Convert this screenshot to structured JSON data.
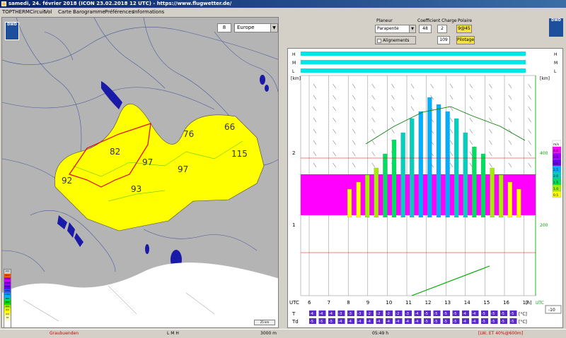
{
  "window": {
    "title": "samedi, 24. février 2018 (ICON 23.02.2018 12 UTC) - https://www.flugwetter.de/"
  },
  "menu": [
    "TOPTHERM",
    "Circuit",
    "Vol",
    "Carte",
    "Barogramme",
    "Préférences",
    "Informations"
  ],
  "map": {
    "zoom_value": "8",
    "region_value": "Europe",
    "logo_text": "DWD",
    "region_numbers": [
      "82",
      "76",
      "66",
      "115",
      "92",
      "97",
      "97",
      "93"
    ],
    "legend_unit": "km",
    "legend_values": [
      "5km",
      "3000",
      "2500",
      "2000",
      "1500",
      "1000",
      "800",
      "600",
      "400",
      "200",
      "100",
      "50"
    ],
    "scale_text": "25 km"
  },
  "controls": {
    "planeur_label": "Planeur",
    "coef_label": "Coefficient",
    "charge_label": "Charge",
    "polaire_label": "Polaire",
    "glider_value": "Parapente",
    "coef_value": "48",
    "charge_value": "2",
    "polaire_value": "9@45",
    "alignements_label": "Alignements",
    "alignements_value": "109",
    "pilotage_label": "Pilotage",
    "logo_text": "DWD"
  },
  "sounding": {
    "hml_labels": [
      "H",
      "M",
      "L"
    ],
    "hml_right_labels": [
      "H",
      "M",
      "L"
    ],
    "y_unit_left": "[km]",
    "y_unit_right": "[km]",
    "y_left_ticks": [
      "2",
      "1"
    ],
    "y_right_ticks": [
      "400",
      "200"
    ],
    "x_label_utc": "UTC",
    "x_ticks": [
      "6",
      "7",
      "8",
      "9",
      "10",
      "11",
      "12",
      "13",
      "14",
      "15",
      "16",
      "17"
    ],
    "x_unit": "[h]",
    "x_unit_right": "UTC",
    "t_label": "T",
    "td_label": "Td",
    "t_values": [
      "-4",
      "-4",
      "-4",
      "-3",
      "-3",
      "-3",
      "-2",
      "-2",
      "-2",
      "-2",
      "-3",
      "-4",
      "-5",
      "-5",
      "-5",
      "-5",
      "-4",
      "-4",
      "-5",
      "-5",
      "-5",
      "-5"
    ],
    "td_values": [
      "-5",
      "-5",
      "-5",
      "-4",
      "-4",
      "-4",
      "-4",
      "-4",
      "-4",
      "-4",
      "-4",
      "-4",
      "-5",
      "-5",
      "-5",
      "-5",
      "-4",
      "-4",
      "-5",
      "-5",
      "-5",
      "-5"
    ],
    "t_unit": "[°C]",
    "td_unit": "[°C]",
    "offset_value": "-10",
    "scale_labels": [
      "m/s",
      "4.0",
      "3.5",
      "3.0",
      "2.5",
      "2.0",
      "1.5",
      "1.0",
      "0.5"
    ]
  },
  "status": {
    "region": "Graubuenden",
    "lmh": "L M H",
    "altitude": "3000 m",
    "time": "05:49 h",
    "info": "[LW, ET 40%@600m]"
  }
}
